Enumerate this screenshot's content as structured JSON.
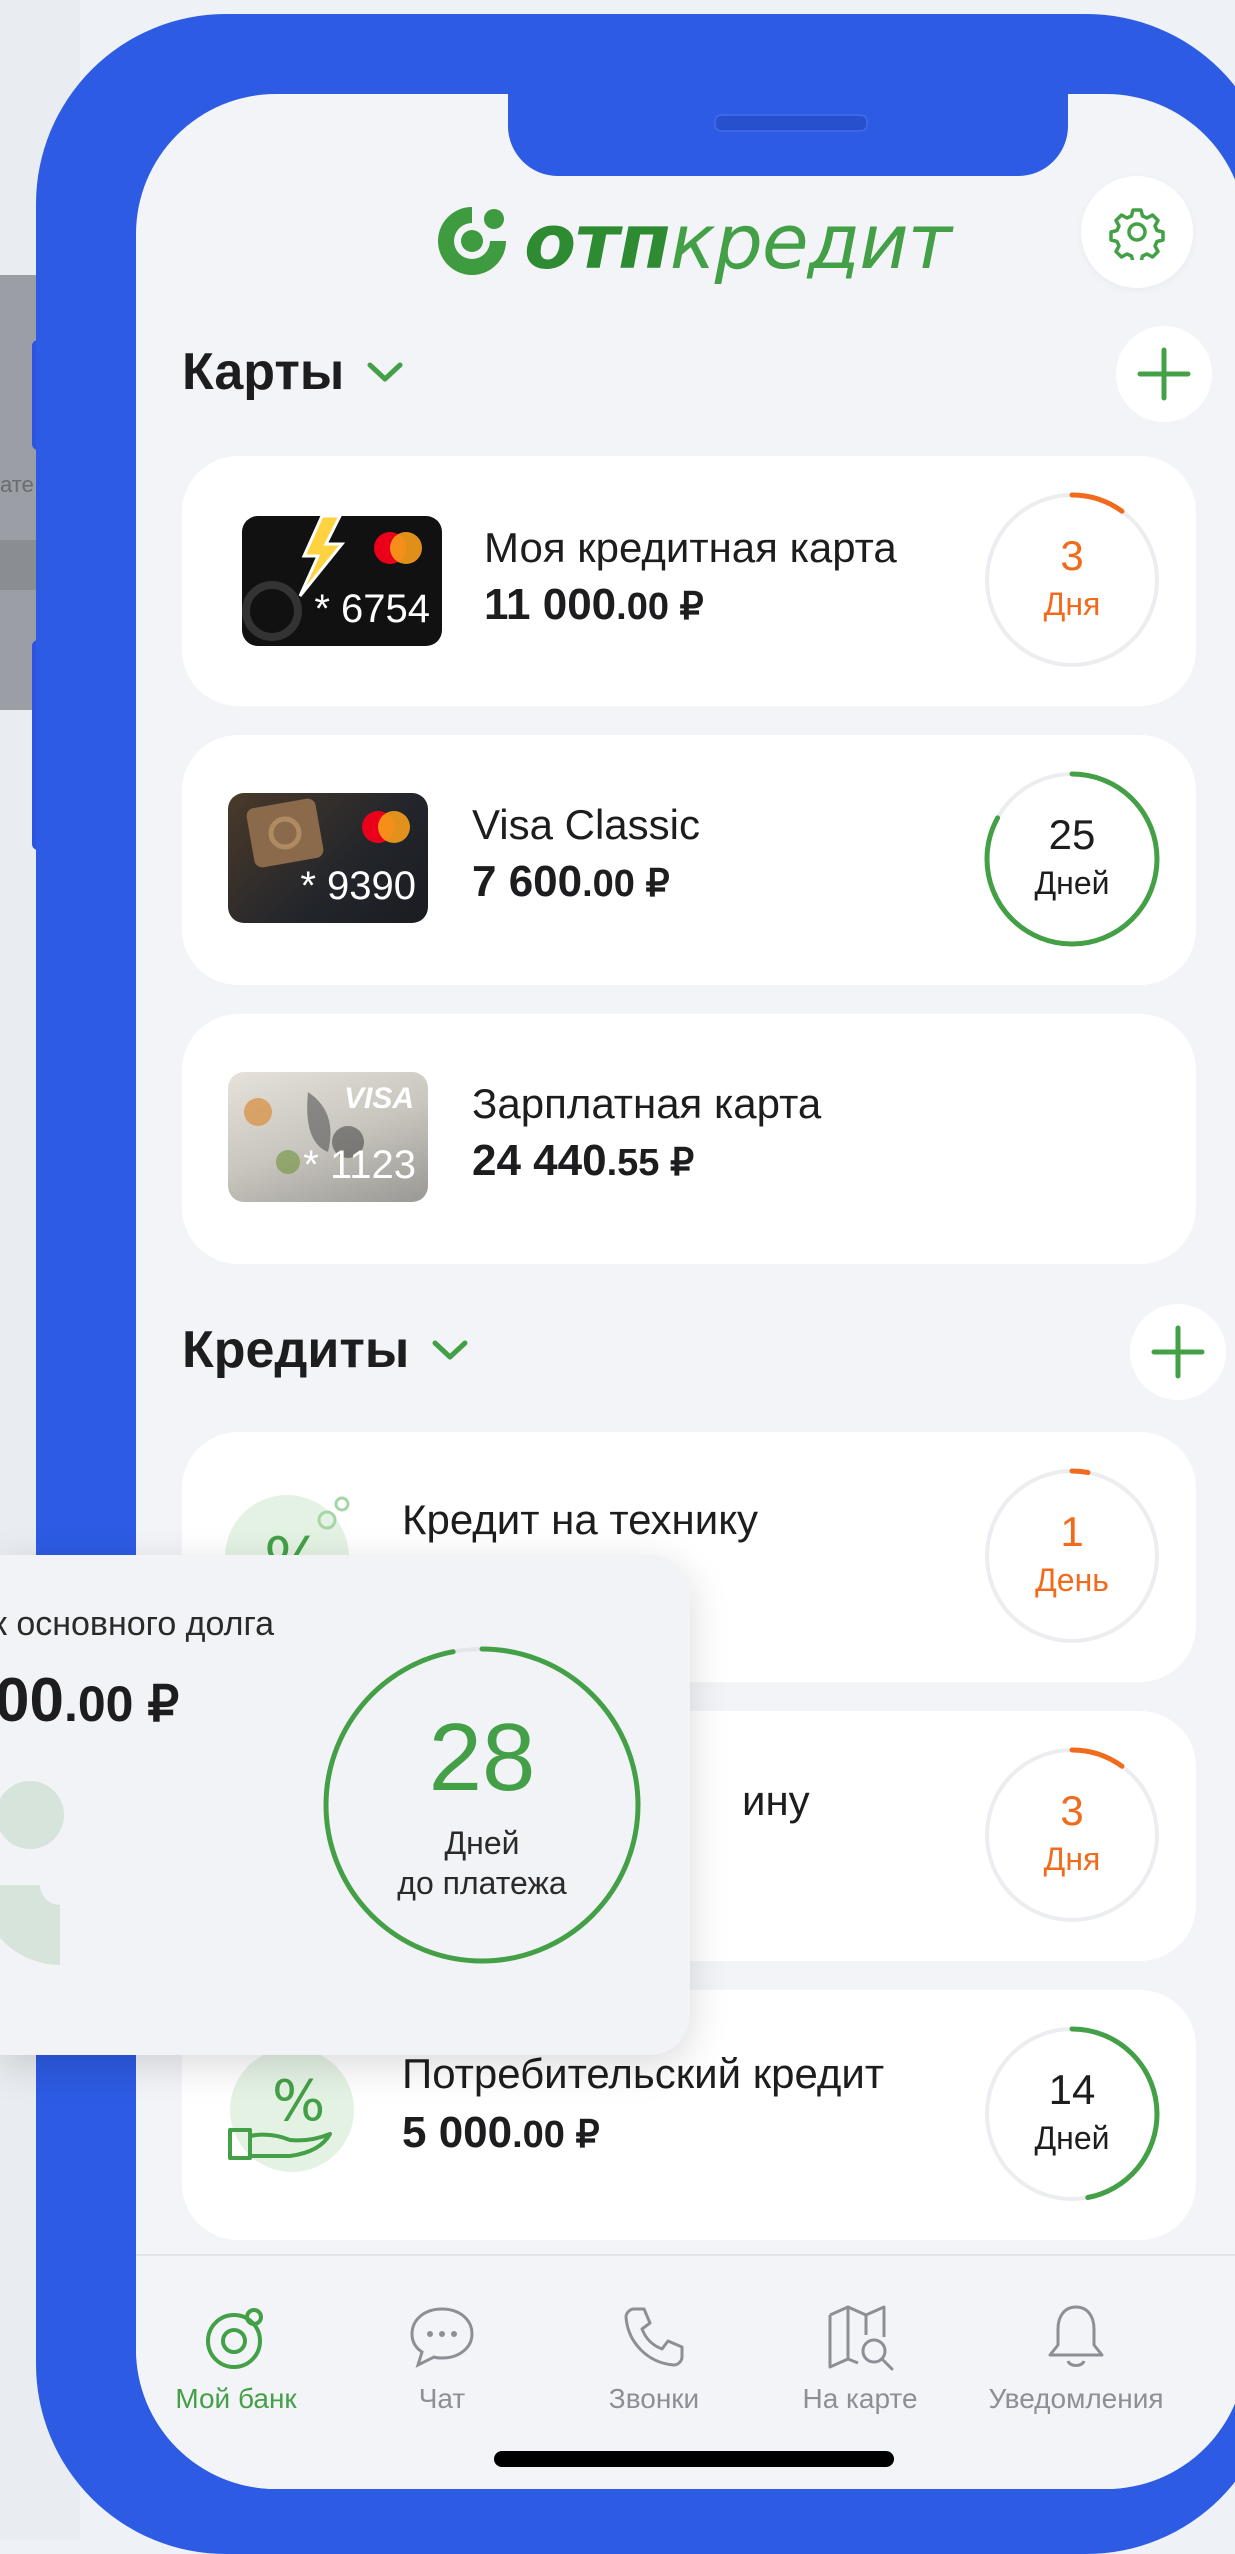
{
  "background": {
    "partial_label": "ате"
  },
  "app": {
    "brand": "отпкредит",
    "brand_bold": "отп",
    "brand_rest": "кредит"
  },
  "colors": {
    "accent": "#43a047",
    "warning": "#f26b1d",
    "phone_frame": "#2d5be3",
    "screen_bg": "#f2f4f8"
  },
  "cards_section": {
    "title": "Карты",
    "items": [
      {
        "mask": "* 6754",
        "title": "Моя кредитная карта",
        "amount_int": "11 000",
        "amount_dec": ".00 ₽",
        "days_num": "3",
        "days_label": "Дня",
        "status": "warning",
        "progress": 0.1
      },
      {
        "mask": "* 9390",
        "title": "Visa Classic",
        "amount_int": "7 600",
        "amount_dec": ".00 ₽",
        "days_num": "25",
        "days_label": "Дней",
        "status": "ok",
        "progress": 0.83
      },
      {
        "mask": "* 1123",
        "title": "Зарплатная карта",
        "amount_int": "24 440",
        "amount_dec": ".55 ₽",
        "thumb_brand": "VISA"
      }
    ]
  },
  "credits_section": {
    "title": "Кредиты",
    "items": [
      {
        "title": "Кредит на технику",
        "days_num": "1",
        "days_label": "День",
        "status": "warning",
        "progress": 0.03
      },
      {
        "title_visible": "ину",
        "days_num": "3",
        "days_label": "Дня",
        "status": "warning",
        "progress": 0.1
      },
      {
        "title": "Потребительский кредит",
        "amount_int": "5 000",
        "amount_dec": ".00 ₽",
        "days_num": "14",
        "days_label": "Дней",
        "status": "ok",
        "progress": 0.47
      }
    ]
  },
  "overlay": {
    "title": "к основного долга",
    "amount": "00.00 ₽",
    "amount_int": "00",
    "amount_dec": ".00 ₽",
    "days_num": "28",
    "days_label_1": "Дней",
    "days_label_2": "до платежа",
    "progress": 0.97
  },
  "tabbar": {
    "items": [
      {
        "label": "Мой банк",
        "icon": "my-bank-icon",
        "active": true
      },
      {
        "label": "Чат",
        "icon": "chat-icon"
      },
      {
        "label": "Звонки",
        "icon": "phone-icon"
      },
      {
        "label": "На карте",
        "icon": "map-icon"
      },
      {
        "label": "Уведомления",
        "icon": "bell-icon"
      }
    ]
  }
}
